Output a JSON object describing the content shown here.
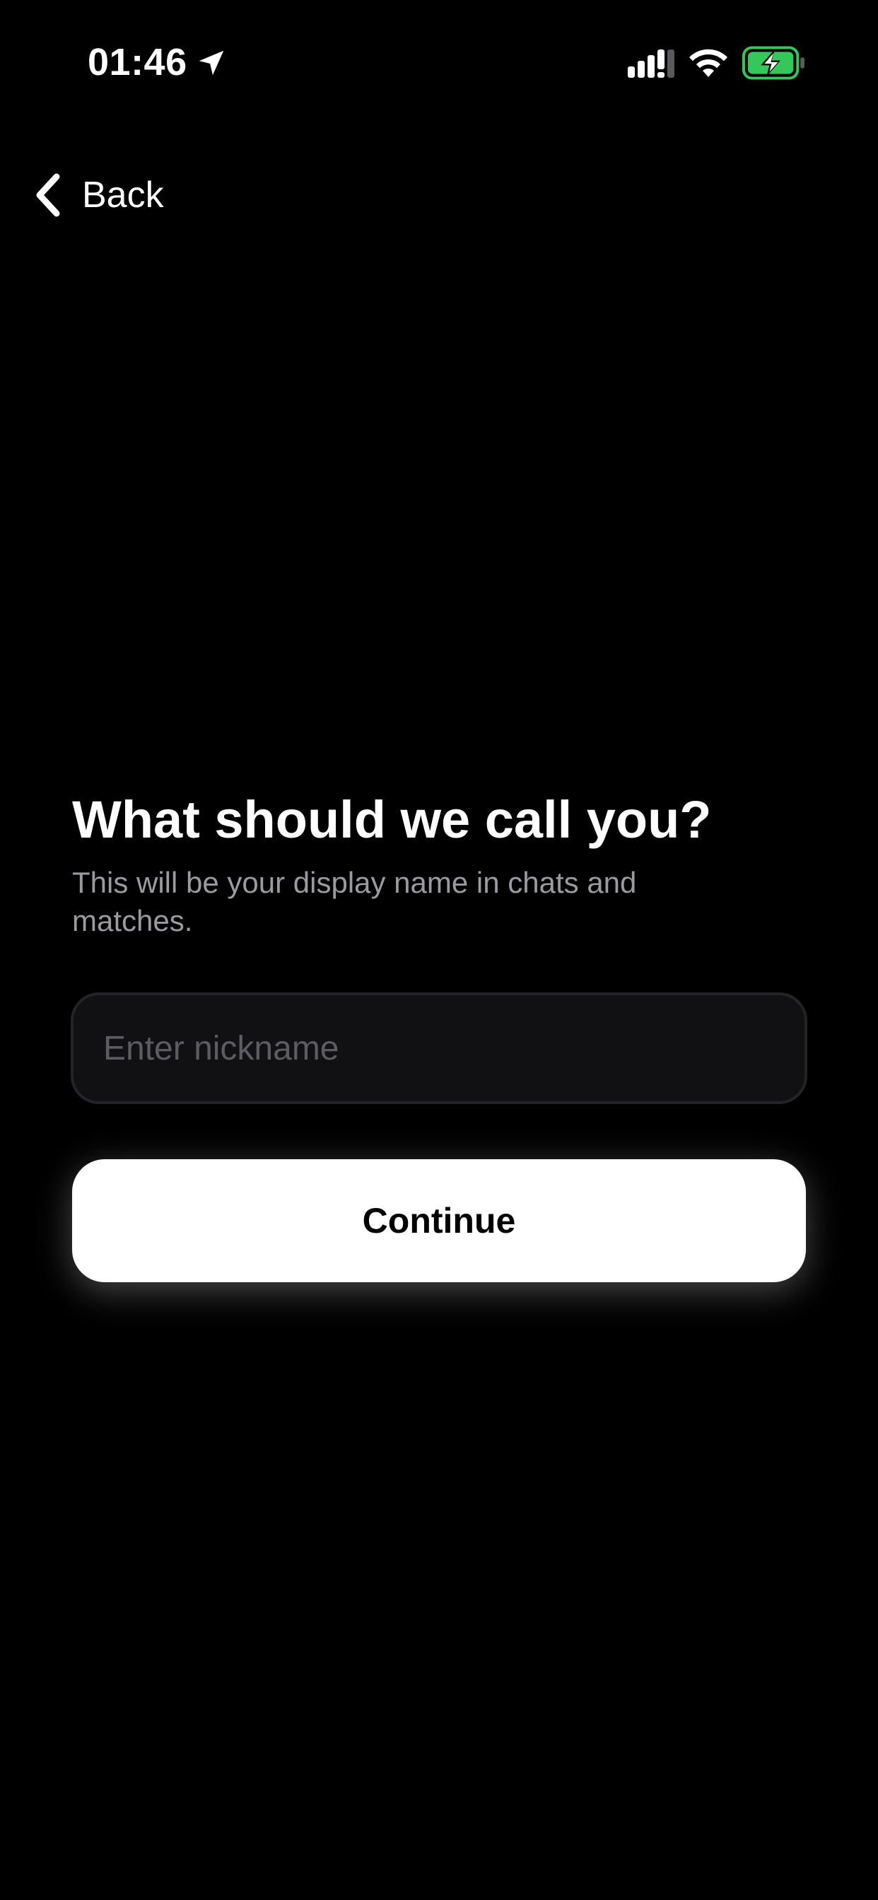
{
  "status_bar": {
    "time": "01:46",
    "icons": [
      "location-arrow-icon",
      "cellular-signal-icon",
      "wifi-icon",
      "battery-charging-icon"
    ],
    "battery_color": "#34c759"
  },
  "nav": {
    "back_label": "Back"
  },
  "onboarding": {
    "title": "What should we call you?",
    "subtitle": "This will be your display name in chats and matches.",
    "nickname_placeholder": "Enter nickname",
    "nickname_value": "",
    "continue_label": "Continue"
  },
  "colors": {
    "background": "#000000",
    "text_primary": "#ffffff",
    "text_secondary": "#9a9a9f",
    "input_background": "#111113",
    "button_background": "#ffffff",
    "button_text": "#000000"
  }
}
